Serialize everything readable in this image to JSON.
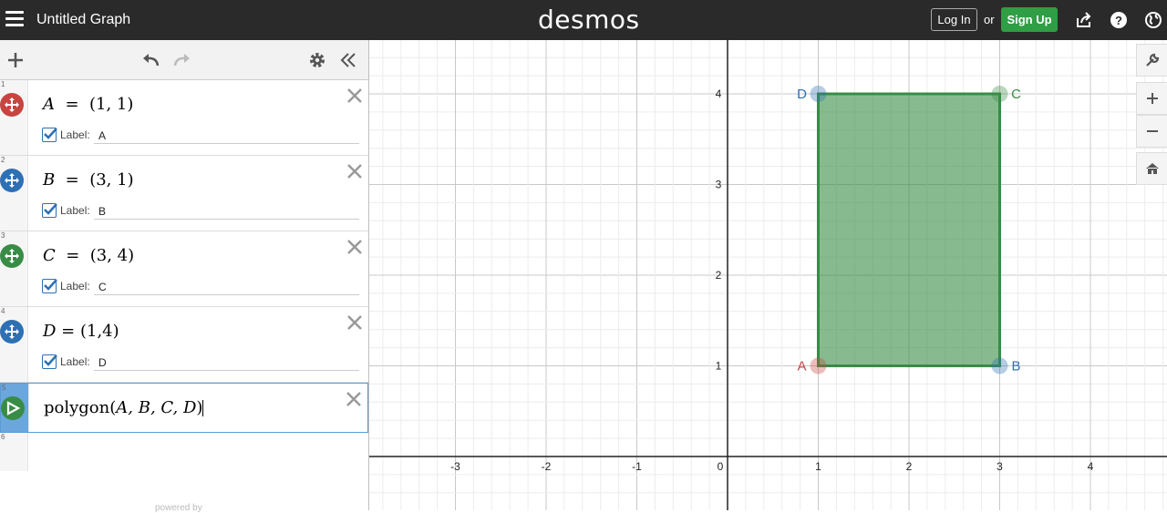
{
  "header": {
    "title": "Untitled Graph",
    "brand": "desmos",
    "login_label": "Log In",
    "or_text": "or",
    "signup_label": "Sign Up",
    "signup_color": "#2f9e44"
  },
  "toolbar": {
    "icons": [
      "add-icon",
      "undo-icon",
      "redo-icon",
      "settings-icon",
      "collapse-icon"
    ]
  },
  "expressions": [
    {
      "index": "1",
      "var": "A",
      "value": "(1, 1)",
      "label_caption": "Label:",
      "label_value": "A",
      "color": "#c74440",
      "icon": "move-point-icon"
    },
    {
      "index": "2",
      "var": "B",
      "value": "(3, 1)",
      "label_caption": "Label:",
      "label_value": "B",
      "color": "#2d70b3",
      "icon": "move-point-icon"
    },
    {
      "index": "3",
      "var": "C",
      "value": "(3, 4)",
      "label_caption": "Label:",
      "label_value": "C",
      "color": "#388c46",
      "icon": "move-point-icon"
    },
    {
      "index": "4",
      "var": "D",
      "value": "(1,4)",
      "label_caption": "Label:",
      "label_value": "D",
      "color": "#2d70b3",
      "icon": "move-point-icon"
    },
    {
      "index": "5",
      "func": "polygon",
      "args": "A, B, C, D",
      "color": "#388c46",
      "icon": "polygon-icon"
    }
  ],
  "empty_expression_index": "6",
  "footer": {
    "powered_text": "powered by"
  },
  "graph": {
    "x_ticks": [
      "-3",
      "-2",
      "-1",
      "0",
      "1",
      "2",
      "3",
      "4"
    ],
    "y_ticks": [
      "1",
      "2",
      "3",
      "4"
    ],
    "points": [
      {
        "name": "A",
        "x": 1,
        "y": 1,
        "color": "#c74440"
      },
      {
        "name": "B",
        "x": 3,
        "y": 1,
        "color": "#2d70b3"
      },
      {
        "name": "C",
        "x": 3,
        "y": 4,
        "color": "#388c46"
      },
      {
        "name": "D",
        "x": 1,
        "y": 4,
        "color": "#2d70b3"
      }
    ],
    "polygon_color": "#388c46"
  },
  "graph_controls": [
    "wrench-icon",
    "zoom-in-icon",
    "zoom-out-icon",
    "home-icon"
  ]
}
